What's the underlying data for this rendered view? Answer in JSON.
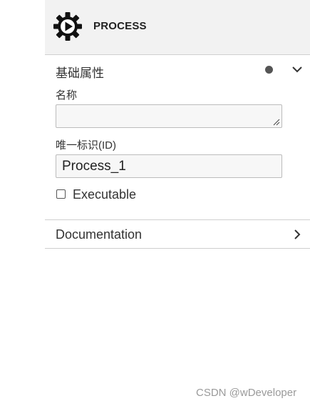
{
  "header": {
    "title": "PROCESS",
    "icon": "process-gear-play-icon"
  },
  "general_group": {
    "title": "基础属性",
    "status_icon": "dot-icon",
    "toggle_icon": "chevron-down-icon",
    "fields": {
      "name": {
        "label": "名称",
        "value": ""
      },
      "id": {
        "label": "唯一标识(ID)",
        "value": "Process_1"
      },
      "executable": {
        "label": "Executable",
        "checked": false
      }
    }
  },
  "documentation_group": {
    "title": "Documentation",
    "toggle_icon": "chevron-right-icon"
  },
  "watermark": "CSDN @wDeveloper"
}
